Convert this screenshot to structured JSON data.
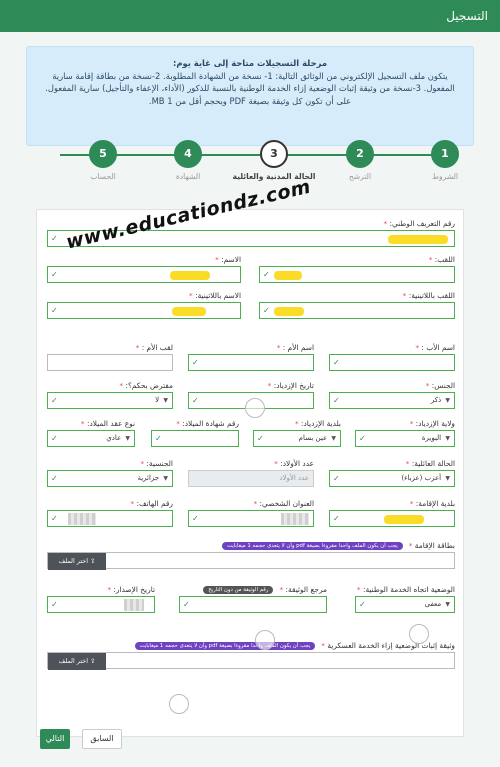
{
  "header": {
    "title": "التسجيل"
  },
  "notice": {
    "title": "مرحلة التسجيلات متاحة إلى غاية يوم:",
    "body": "يتكون ملف التسجيل الإلكتروني من الوثائق التالية: 1- نسخة من الشهادة المطلوبة. 2-نسخة من بطاقة إقامة سارية المفعول. 3-نسخة من وثيقة إثبات الوضعية إزاء الخدمة الوطنية بالنسبة للذكور (الأداء، الإعفاء والتأجيل) سارية المفعول. على أن تكون كل وثيقة بصيغة PDF وبحجم أقل من 1 MB."
  },
  "steps": [
    {
      "num": "1",
      "label": "الشروط"
    },
    {
      "num": "2",
      "label": "الترشح"
    },
    {
      "num": "3",
      "label": "الحالة المدنية والعائلية"
    },
    {
      "num": "4",
      "label": "الشهادة"
    },
    {
      "num": "5",
      "label": "الحساب"
    }
  ],
  "watermark": "www.educationdz.com",
  "form": {
    "nin": {
      "label": "رقم التعريف الوطني:",
      "req": "*"
    },
    "lastname": {
      "label": "اللقب:",
      "req": "*"
    },
    "firstname": {
      "label": "الاسم:",
      "req": "*"
    },
    "lastname_latin": {
      "label": "اللقب باللاتينية:",
      "req": "*"
    },
    "firstname_latin": {
      "label": "الاسم باللاتينية:",
      "req": "*"
    },
    "father_name": {
      "label": "اسم الأب :",
      "req": "*"
    },
    "mother_name": {
      "label": "اسم الأم :",
      "req": "*"
    },
    "mother_lastname": {
      "label": "لقب الأم :",
      "req": "*"
    },
    "gender": {
      "label": "الجنس:",
      "req": "*",
      "value": "ذكر"
    },
    "birth_date": {
      "label": "تاريخ الإزدياد:",
      "req": "*"
    },
    "presumed": {
      "label": "مفترض بحكم؟:",
      "req": "*",
      "value": "لا"
    },
    "birth_wilaya": {
      "label": "ولاية الإزدياد:",
      "req": "*",
      "value": "البويرة"
    },
    "birth_commune": {
      "label": "بلدية الإزدياد:",
      "req": "*",
      "value": "عين بسام"
    },
    "birth_cert_num": {
      "label": "رقم شهادة الميلاد:",
      "req": "*"
    },
    "birth_cert_type": {
      "label": "نوع عقد الميلاد:",
      "req": "*",
      "value": "عادي"
    },
    "marital": {
      "label": "الحالة العائلية:",
      "req": "*",
      "value": "أعزب (عزباء)"
    },
    "children": {
      "label": "عدد الأولاد:",
      "req": "*",
      "placeholder": "عدد الأولاد"
    },
    "nationality": {
      "label": "الجنسية:",
      "req": "*",
      "value": "جزائرية"
    },
    "residence_commune": {
      "label": "بلدية الإقامة:",
      "req": "*"
    },
    "address": {
      "label": "العنوان الشخصي:",
      "req": "*"
    },
    "phone": {
      "label": "رقم الهاتف:",
      "req": "*"
    },
    "residence_card": {
      "label": "بطاقة الإقامة",
      "req": "*",
      "hint": "يجب أن يكون الملف واحدا مقروءا بصيغة pdf وأن لا يتعدى حجمه 1 ميغابايت",
      "file_btn": "اختر الملف"
    },
    "ns_status": {
      "label": "الوضعية اتجاه الخدمة الوطنية:",
      "req": "*",
      "value": "معفى"
    },
    "doc_ref": {
      "label": "مرجع الوثيقة:",
      "req": "*",
      "hint": "رقم الوثيقة من دون التاريخ"
    },
    "issue_date": {
      "label": "تاريخ الإصدار:",
      "req": "*"
    },
    "ns_doc": {
      "label": "وثيقة إثبات الوضعية إزاء الخدمة العسكرية",
      "req": "*",
      "hint": "يجب أن يكون الملف واحدا مقروءا بصيغة pdf وأن لا يتعدى حجمه 1 ميغابايت",
      "file_btn": "اختر الملف"
    }
  },
  "footer": {
    "prev": "السابق",
    "next": "التالي"
  }
}
